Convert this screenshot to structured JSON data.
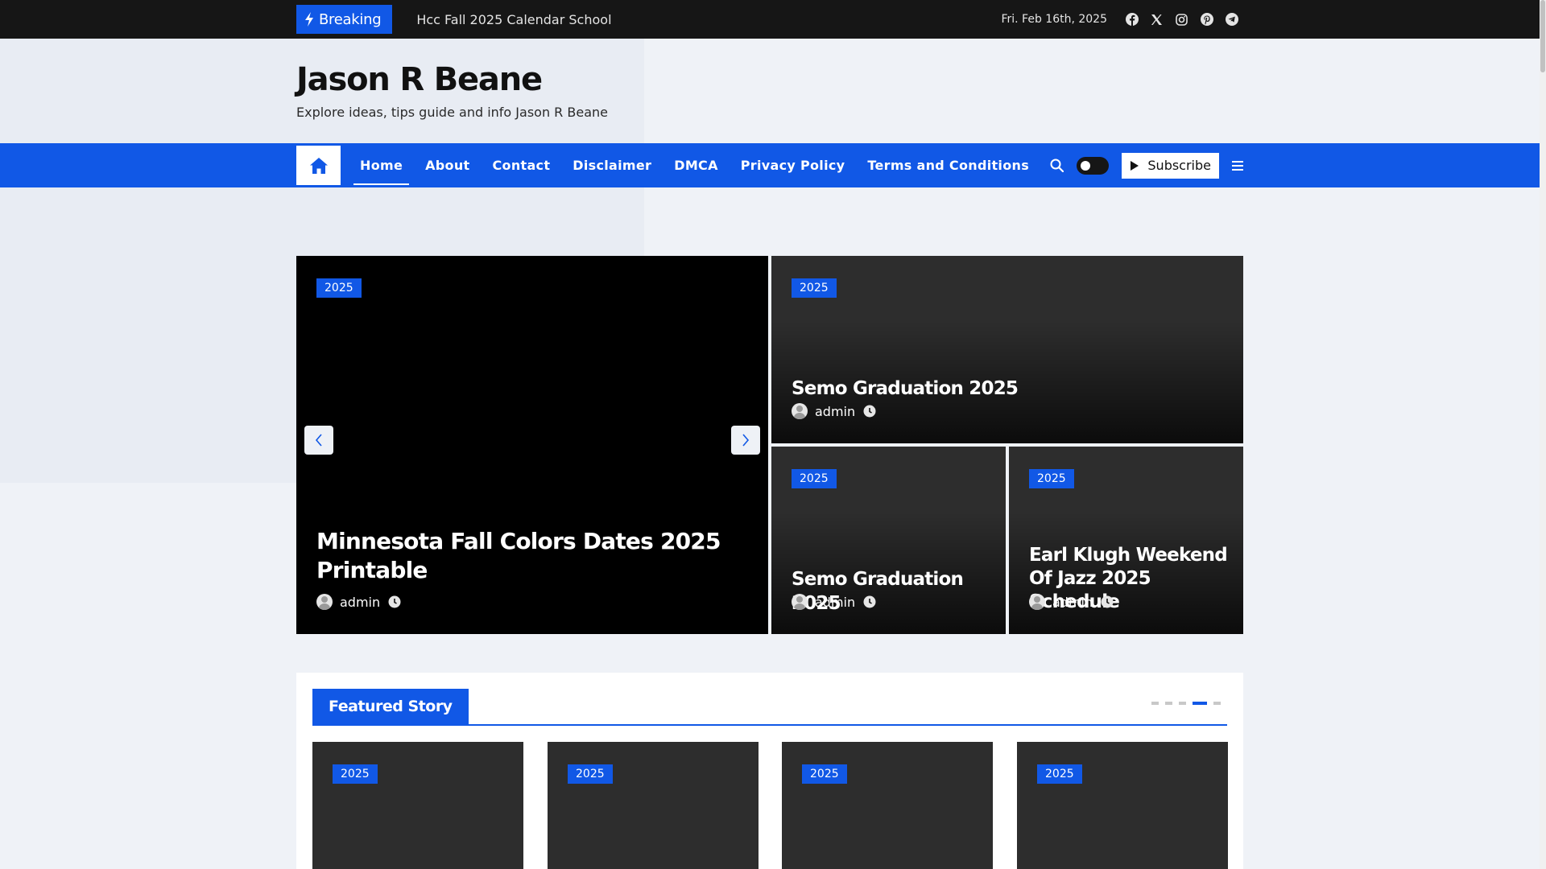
{
  "topbar": {
    "breaking_label": "Breaking",
    "ticker_text": "Hcc Fall 2025 Calendar School",
    "date": "Fri. Feb 16th, 2025",
    "social_icons": [
      "facebook-icon",
      "x-twitter-icon",
      "instagram-icon",
      "pinterest-icon",
      "telegram-icon"
    ]
  },
  "site": {
    "title": "Jason R Beane",
    "tagline": "Explore ideas, tips guide and info Jason R Beane"
  },
  "nav": {
    "items": [
      {
        "label": "Home"
      },
      {
        "label": "About"
      },
      {
        "label": "Contact"
      },
      {
        "label": "Disclaimer"
      },
      {
        "label": "DMCA"
      },
      {
        "label": "Privacy Policy"
      },
      {
        "label": "Terms and Conditions"
      }
    ],
    "active_index": 0,
    "subscribe_label": "Subscribe"
  },
  "hero": {
    "main": {
      "tag": "2025",
      "title": "Minnesota Fall Colors Dates 2025 Printable",
      "author": "admin"
    },
    "top_right": {
      "tag": "2025",
      "title": "Semo Graduation 2025",
      "author": "admin"
    },
    "bottom_left": {
      "tag": "2025",
      "title": "Semo Graduation 2025",
      "author": "admin"
    },
    "bottom_right": {
      "tag": "2025",
      "title": "Earl Klugh Weekend Of Jazz 2025 Schedule",
      "author": "admin"
    }
  },
  "featured": {
    "title": "Featured Story",
    "cards": [
      {
        "tag": "2025"
      },
      {
        "tag": "2025"
      },
      {
        "tag": "2025"
      },
      {
        "tag": "2025"
      }
    ],
    "dot_count": 5,
    "active_dot": 3
  },
  "colors": {
    "accent": "#1158e6",
    "topbar_bg": "#161616",
    "page_bg": "#eff2f7",
    "card_bg": "#2d2d2d"
  }
}
